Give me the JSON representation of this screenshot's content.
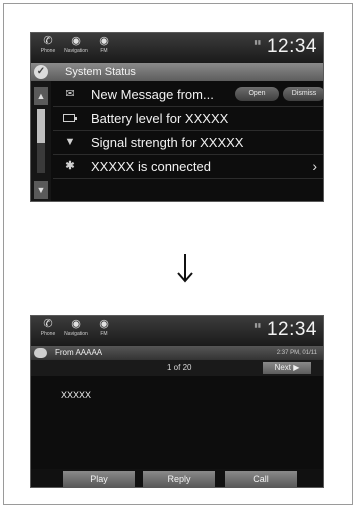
{
  "topbar": {
    "buttons": [
      {
        "label": "Phone",
        "icon": "phone-icon"
      },
      {
        "label": "Navigation",
        "icon": "navigation-icon"
      },
      {
        "label": "FM",
        "icon": "radio-icon"
      }
    ],
    "clock": "12:34"
  },
  "screen1": {
    "header_title": "System Status",
    "rows": [
      {
        "text": "New Message from...",
        "icon": "envelope-icon",
        "actions": [
          "Open",
          "Dismiss"
        ]
      },
      {
        "text": "Battery level for XXXXX",
        "icon": "battery-icon"
      },
      {
        "text": "Signal strength for XXXXX",
        "icon": "signal-icon"
      },
      {
        "text": "XXXXX is connected",
        "icon": "bluetooth-icon"
      }
    ]
  },
  "screen2": {
    "from": "From AAAAA",
    "time": "2:37 PM, 01/11",
    "page": "1 of 20",
    "next_label": "Next",
    "message": "XXXXX",
    "buttons": [
      "Play",
      "Reply",
      "Call"
    ]
  },
  "colors": {
    "screen_bg": "#0d0d0d",
    "header_gray": "#6f6f6f",
    "text": "#f2f2f2"
  }
}
